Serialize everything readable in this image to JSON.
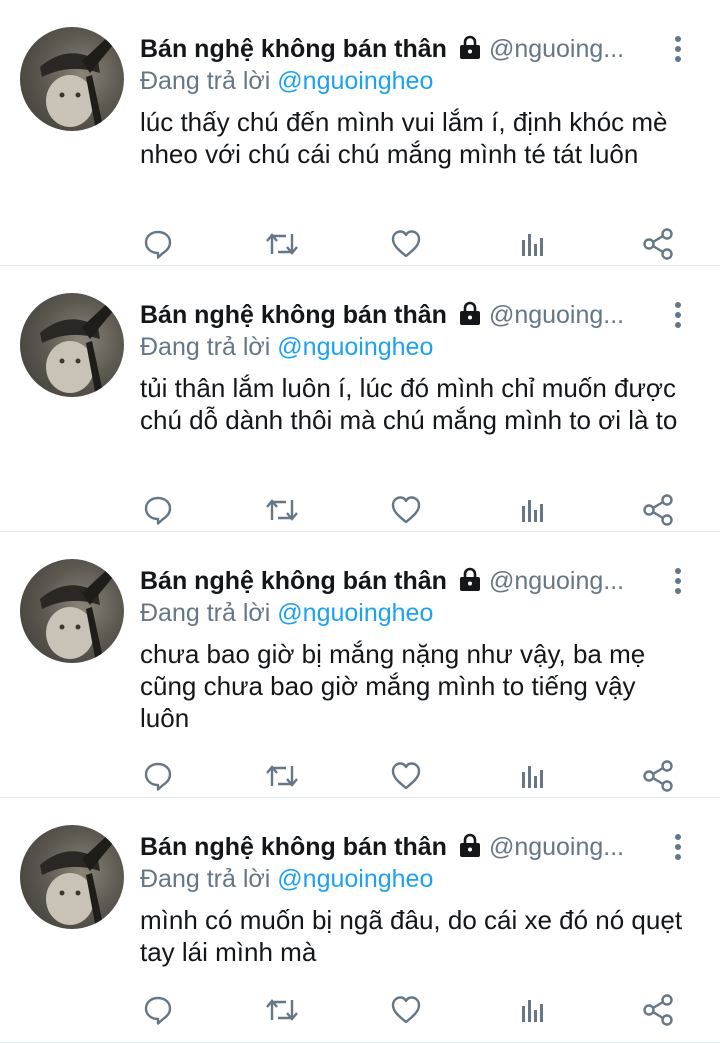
{
  "colors": {
    "text": "#14171a",
    "secondary": "#657786",
    "link": "#1da1f2",
    "divider": "#e1e8ed"
  },
  "icons": [
    "protected-lock-icon",
    "more-vertical-icon",
    "reply-icon",
    "retweet-icon",
    "like-icon",
    "analytics-icon",
    "share-icon"
  ],
  "tweets": [
    {
      "display_name": "Bán nghệ không bán thân",
      "handle": "@nguoing...",
      "replying_label": "Đang trả lời",
      "replying_to": "@nguoingheo",
      "text": "lúc thấy chú đến mình vui lắm í, định khóc mè nheo với chú cái chú mắng mình té tát luôn"
    },
    {
      "display_name": "Bán nghệ không bán thân",
      "handle": "@nguoing...",
      "replying_label": "Đang trả lời",
      "replying_to": "@nguoingheo",
      "text": "tủi thân lắm luôn í, lúc đó mình chỉ muốn được chú dỗ dành thôi mà chú mắng mình to ơi là to"
    },
    {
      "display_name": "Bán nghệ không bán thân",
      "handle": "@nguoing...",
      "replying_label": "Đang trả lời",
      "replying_to": "@nguoingheo",
      "text": "chưa bao giờ bị mắng nặng như vậy, ba mẹ cũng chưa bao giờ mắng mình to tiếng vậy luôn"
    },
    {
      "display_name": "Bán nghệ không bán thân",
      "handle": "@nguoing...",
      "replying_label": "Đang trả lời",
      "replying_to": "@nguoingheo",
      "text": "mình có muốn bị ngã đâu, do cái xe đó nó quẹt tay lái mình mà"
    }
  ]
}
